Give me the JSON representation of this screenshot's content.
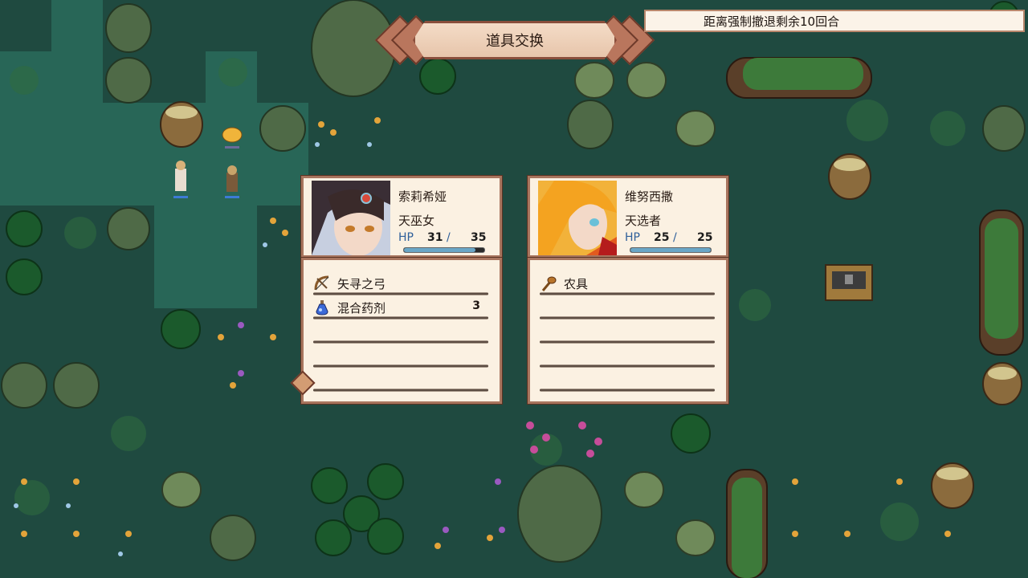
{
  "banner": {
    "title": "道具交换"
  },
  "status": {
    "text": "距离强制撤退剩余10回合"
  },
  "left": {
    "name": "索莉希娅",
    "class": "天巫女",
    "hp_label": "HP",
    "hp_current": "31",
    "hp_max": "35",
    "hp_fraction": 0.886,
    "items": [
      {
        "icon": "bow-icon",
        "label": "矢寻之弓",
        "qty": ""
      },
      {
        "icon": "potion-icon",
        "label": "混合药剂",
        "qty": "3"
      },
      {
        "icon": "",
        "label": "",
        "qty": ""
      },
      {
        "icon": "",
        "label": "",
        "qty": ""
      },
      {
        "icon": "",
        "label": "",
        "qty": ""
      }
    ]
  },
  "right": {
    "name": "维努西撒",
    "class": "天选者",
    "hp_label": "HP",
    "hp_current": "25",
    "hp_max": "25",
    "hp_fraction": 1.0,
    "items": [
      {
        "icon": "farm-tool-icon",
        "label": "农具",
        "qty": ""
      },
      {
        "icon": "",
        "label": "",
        "qty": ""
      },
      {
        "icon": "",
        "label": "",
        "qty": ""
      },
      {
        "icon": "",
        "label": "",
        "qty": ""
      },
      {
        "icon": "",
        "label": "",
        "qty": ""
      }
    ]
  },
  "colors": {
    "panel_bg": "#fbf1e2",
    "panel_border": "#a8755e",
    "hp_fill": "#6aa6c6",
    "map_bg": "#1f4a40"
  }
}
